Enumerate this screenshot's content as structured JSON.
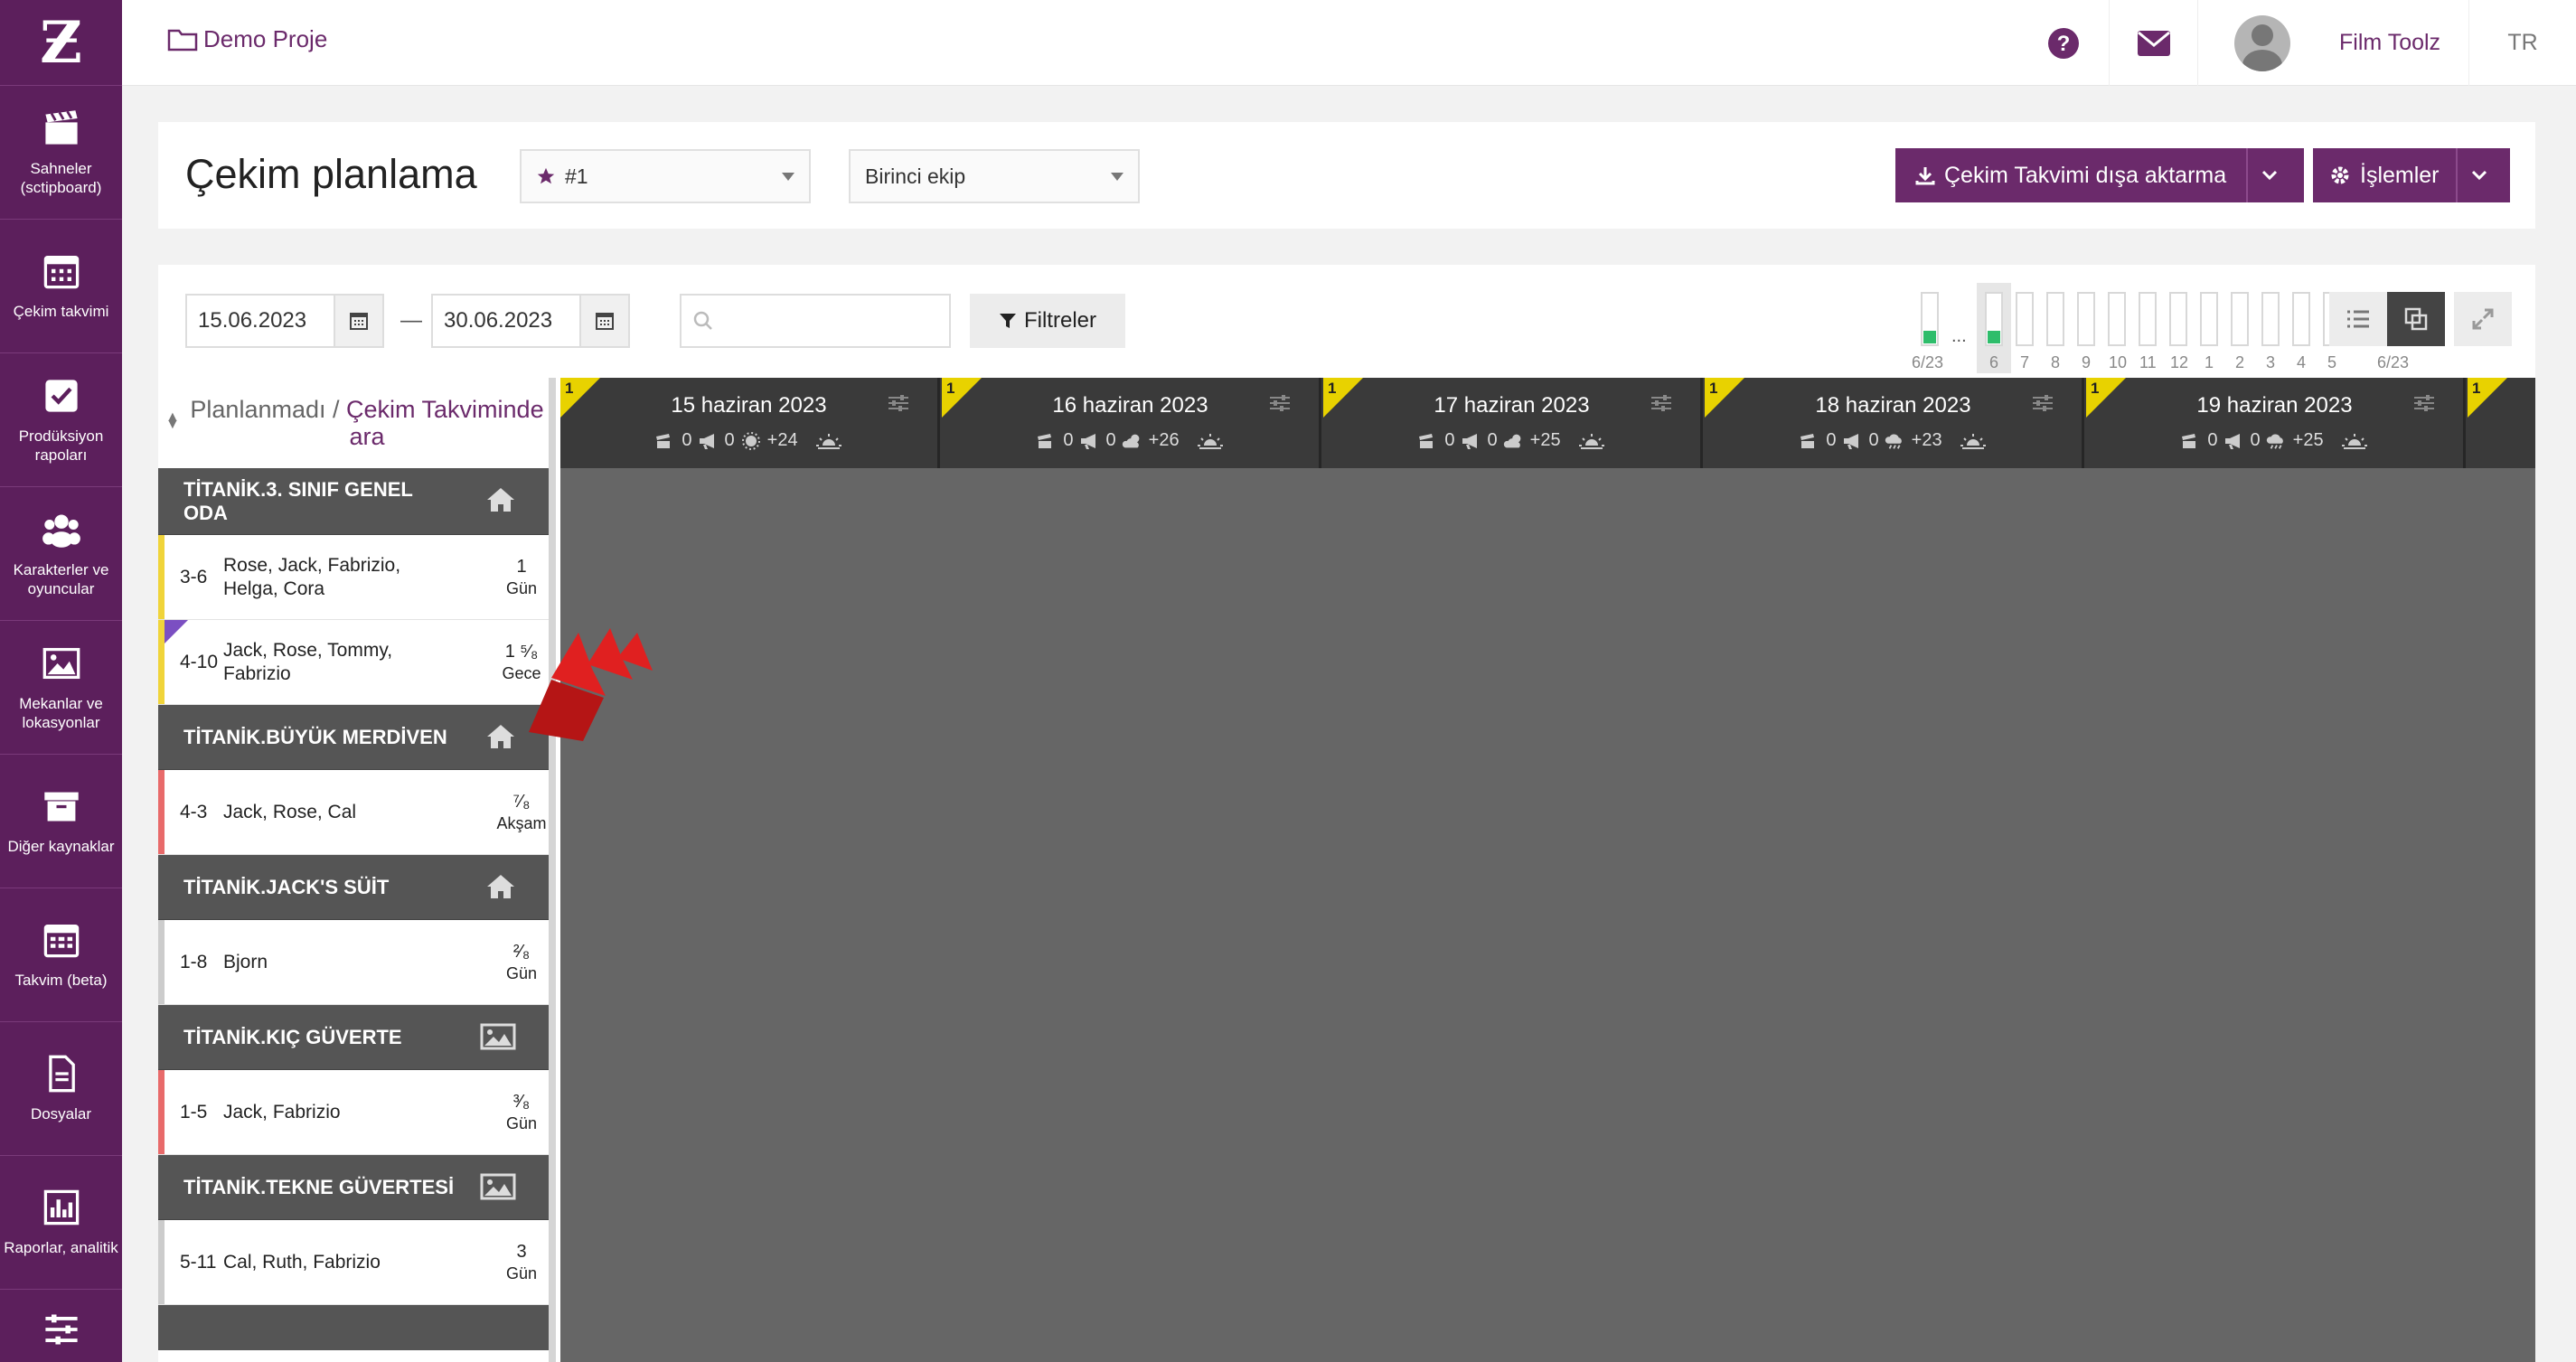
{
  "app": {
    "logo": "Ƶ"
  },
  "sidebar": {
    "items": [
      {
        "label": "Sahneler (sctipboard)",
        "icon": "clapperboard-icon"
      },
      {
        "label": "Çekim takvimi",
        "icon": "calendar-icon"
      },
      {
        "label": "Prodüksiyon rapoları",
        "icon": "checkbox-icon"
      },
      {
        "label": "Karakterler ve oyuncular",
        "icon": "users-icon"
      },
      {
        "label": "Mekanlar ve lokasyonlar",
        "icon": "image-icon"
      },
      {
        "label": "Diğer kaynaklar",
        "icon": "archive-icon"
      },
      {
        "label": "Takvim (beta)",
        "icon": "calendar-grid-icon"
      },
      {
        "label": "Dosyalar",
        "icon": "file-icon"
      },
      {
        "label": "Raporlar, analitik",
        "icon": "bar-chart-icon"
      },
      {
        "label": "",
        "icon": "sliders-icon"
      }
    ]
  },
  "topbar": {
    "project": "Demo Proje",
    "user": "Film Toolz",
    "lang": "TR"
  },
  "header": {
    "title": "Çekim planlama",
    "schedule_select": "#1",
    "team_select": "Birinci ekip",
    "export_label": "Çekim Takvimi dışa aktarma",
    "actions_label": "İşlemler"
  },
  "toolbar": {
    "date_from": "15.06.2023",
    "date_to": "30.06.2023",
    "date_sep": "—",
    "search_placeholder": "",
    "filters_label": "Filtreler",
    "mini_labels": [
      "6/23",
      "6",
      "7",
      "8",
      "9",
      "10",
      "11",
      "12",
      "1",
      "2",
      "3",
      "4",
      "5",
      "6/23"
    ],
    "mini_dots": "..."
  },
  "scene_list": {
    "header_text": "Planlanmadı / ",
    "header_link": "Çekim Takviminde ara",
    "groups": [
      {
        "location": "TİTANİK.3. SINIF GENEL ODA",
        "type": "home-icon",
        "scenes": [
          {
            "num": "3-6",
            "chars": "Rose, Jack, Fabrizio, Helga, Cora",
            "len": "1",
            "time": "Gün",
            "color": "#f0d43a",
            "mark": false
          },
          {
            "num": "4-10",
            "chars": "Jack, Rose, Tommy, Fabrizio",
            "len": "1 ⁵⁄₈",
            "time": "Gece",
            "color": "#f0d43a",
            "mark": true
          }
        ]
      },
      {
        "location": "TİTANİK.BÜYÜK MERDİVEN",
        "type": "home-icon",
        "scenes": [
          {
            "num": "4-3",
            "chars": "Jack, Rose, Cal",
            "len": "⁷⁄₈",
            "time": "Akşam",
            "color": "#e86a6a",
            "mark": false
          }
        ]
      },
      {
        "location": "TİTANİK.JACK'S SÜİT",
        "type": "home-icon",
        "scenes": [
          {
            "num": "1-8",
            "chars": "Bjorn",
            "len": "²⁄₈",
            "time": "Gün",
            "color": "#cccccc",
            "mark": false
          }
        ]
      },
      {
        "location": "TİTANİK.KIÇ GÜVERTE",
        "type": "landscape-icon",
        "scenes": [
          {
            "num": "1-5",
            "chars": "Jack, Fabrizio",
            "len": "³⁄₈",
            "time": "Gün",
            "color": "#e86a6a",
            "mark": false
          }
        ]
      },
      {
        "location": "TİTANİK.TEKNE GÜVERTESİ",
        "type": "landscape-icon",
        "scenes": [
          {
            "num": "5-11",
            "chars": "Cal, Ruth, Fabrizio",
            "len": "3",
            "time": "Gün",
            "color": "#cccccc",
            "mark": false
          }
        ]
      }
    ]
  },
  "calendar": {
    "days": [
      {
        "flag": "1",
        "date": "15 haziran 2023",
        "scenes": "0",
        "ads": "0",
        "weather": "sun-icon",
        "temp": "+24"
      },
      {
        "flag": "1",
        "date": "16 haziran 2023",
        "scenes": "0",
        "ads": "0",
        "weather": "cloud-sun-icon",
        "temp": "+26"
      },
      {
        "flag": "1",
        "date": "17 haziran 2023",
        "scenes": "0",
        "ads": "0",
        "weather": "cloud-sun-icon",
        "temp": "+25"
      },
      {
        "flag": "1",
        "date": "18 haziran 2023",
        "scenes": "0",
        "ads": "0",
        "weather": "cloud-rain-icon",
        "temp": "+23"
      },
      {
        "flag": "1",
        "date": "19 haziran 2023",
        "scenes": "0",
        "ads": "0",
        "weather": "cloud-rain-icon",
        "temp": "+25"
      },
      {
        "flag": "1",
        "date": "",
        "scenes": "",
        "ads": "",
        "weather": "",
        "temp": ""
      }
    ]
  },
  "colors": {
    "brand": "#6b2a6b",
    "accent_red": "#e02020",
    "day_flag": "#e8d200",
    "sun_bar": "#2ebd6b"
  }
}
